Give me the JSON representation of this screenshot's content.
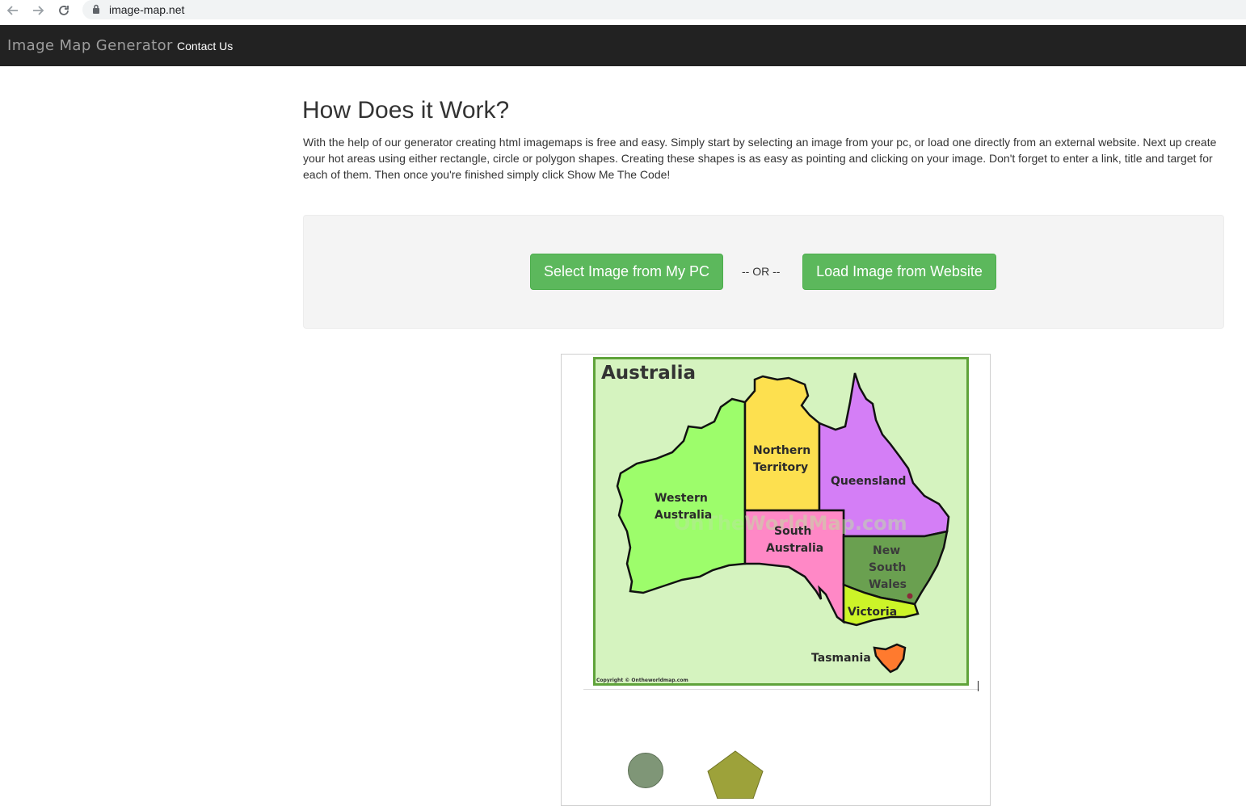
{
  "browser": {
    "url": "image-map.net"
  },
  "navbar": {
    "brand": "Image Map Generator",
    "links": [
      "Contact Us"
    ]
  },
  "main": {
    "heading": "How Does it Work?",
    "intro": "With the help of our generator creating html imagemaps is free and easy. Simply start by selecting an image from your pc, or load one directly from an external website. Next up create your hot areas using either rectangle, circle or polygon shapes. Creating these shapes is as easy as pointing and clicking on your image. Don't forget to enter a link, title and target for each of them. Then once you're finished simply click Show Me The Code!",
    "select_pc_label": "Select Image from My PC",
    "or_label": "-- OR --",
    "load_web_label": "Load Image from Website"
  },
  "map": {
    "title": "Australia",
    "regions": {
      "wa": [
        "Western",
        "Australia"
      ],
      "nt": [
        "Northern",
        "Territory"
      ],
      "qld": "Queensland",
      "sa": [
        "South",
        "Australia"
      ],
      "nsw": [
        "New",
        "South",
        "Wales"
      ],
      "vic": "Victoria",
      "tas": "Tasmania"
    },
    "watermark": "OnTheWorldMap.com",
    "copyright": "Copyright © Ontheworldmap.com"
  },
  "colors": {
    "navbar_bg": "#222222",
    "button_green": "#5cb85c",
    "wa": "#9dfd6b",
    "nt": "#fde04f",
    "qld": "#d47ef6",
    "sa": "#ff88c6",
    "nsw": "#6aa050",
    "vic": "#ccf428",
    "tas": "#ff7a2e"
  }
}
